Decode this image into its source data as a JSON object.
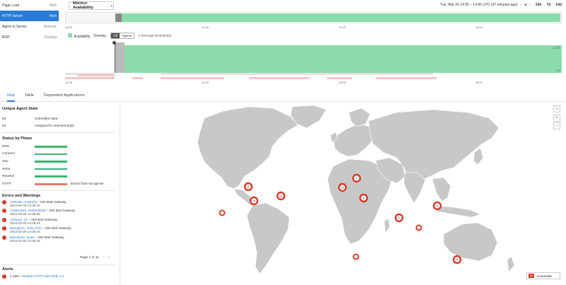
{
  "tests": [
    {
      "name": "Page Load",
      "type": "Web",
      "active": false
    },
    {
      "name": "HTTP Server",
      "type": "Web",
      "active": true
    },
    {
      "name": "Agent to Server",
      "type": "Network",
      "active": false
    },
    {
      "name": "BGP",
      "type": "Routing",
      "active": false
    }
  ],
  "metrics": {
    "label": "Metrics: Availability"
  },
  "timebar": {
    "range_text": "Tue, Mar 26 14:35 – 14:36 UTC (47 minutes ago)",
    "prev": "‹",
    "stop": "■",
    "next": "›",
    "r24": "24h",
    "r7": "7d",
    "r14": "14d"
  },
  "overview_ticks": [
    "14:00",
    "14:40",
    "15:20",
    "16:10"
  ],
  "legend": {
    "series": "Availability",
    "overlay_label": "Overlay:",
    "off": "Off",
    "agents": "Agents",
    "avg": "Average Availability"
  },
  "chart": {
    "pct_top": "100%",
    "pct_bottom": "0%"
  },
  "main_ticks": [
    "14:36",
    "14:40",
    "15:00",
    "16:10"
  ],
  "tabs": [
    "Map",
    "Table",
    "Dependent Applications"
  ],
  "unique": {
    "title": "Unique Agent Stats",
    "rows": [
      {
        "n": "53",
        "label": "Submitted data"
      },
      {
        "n": "53",
        "label": "Assigned to selected tests"
      }
    ]
  },
  "phases": {
    "title": "Status by Phase",
    "items": [
      {
        "label": "DNS",
        "status": "ok",
        "note": ""
      },
      {
        "label": "Connect",
        "status": "ok",
        "note": ""
      },
      {
        "label": "SSL",
        "status": "ok",
        "note": ""
      },
      {
        "label": "Send",
        "status": "ok",
        "note": ""
      },
      {
        "label": "Receive",
        "status": "ok",
        "note": ""
      },
      {
        "label": "HTTP",
        "status": "error",
        "note": "Errors from 53 agents"
      }
    ]
  },
  "errors": {
    "title": "Errors and Warnings",
    "items": [
      {
        "city": "Adelaide, Australia",
        "msg": " – 502 Bad Gateway",
        "ts": "2024-03-26 14:35:34"
      },
      {
        "city": "Amsterdam, Netherlands",
        "msg": " – 502 Bad Gateway",
        "ts": "2024-03-26 14:35:36"
      },
      {
        "city": "Ashburn, VA",
        "msg": " – 502 Bad Gateway",
        "ts": "2024-03-26 14:35:33"
      },
      {
        "city": "Bangalore, India (JIO)",
        "msg": " – 502 Bad Gateway",
        "ts": "2024-03-26 14:35:34"
      },
      {
        "city": "Barcelona, Spain",
        "msg": " – 502 Bad Gateway",
        "ts": "2024-03-26 14:35:35"
      }
    ],
    "pager": "Page 1 of 11"
  },
  "alerts": {
    "title": "Alerts",
    "count_text": "1 alert – ",
    "link": "Default HTTP Alert Rule 2.0"
  },
  "map": {
    "clusters": [
      "2",
      "11",
      "3",
      "2",
      "3",
      "11",
      "",
      "2",
      "",
      "3",
      "",
      "",
      "4"
    ],
    "unavailable_count": "53",
    "unavailable_label": "Unavailable",
    "zoom_in": "+",
    "zoom_out": "−",
    "home": "⌂"
  },
  "colors": {
    "accent": "#2a7bd6",
    "ok": "#3cb371",
    "error": "#d63b2a",
    "availability": "#8bdbab"
  }
}
